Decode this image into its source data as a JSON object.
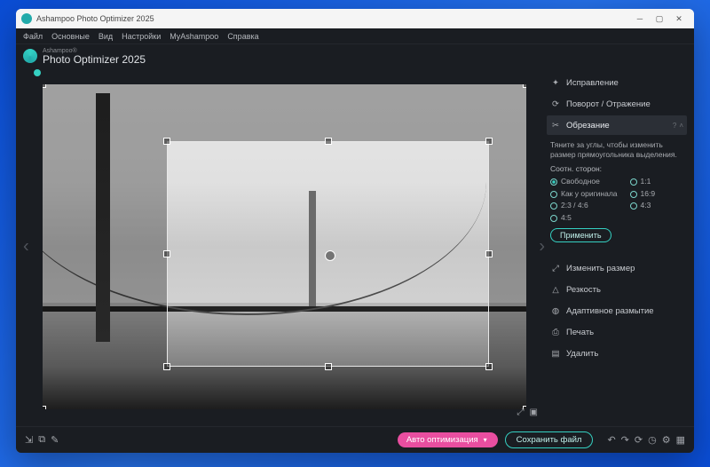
{
  "window": {
    "title": "Ashampoo Photo Optimizer 2025"
  },
  "menu": {
    "file": "Файл",
    "main": "Основные",
    "view": "Вид",
    "settings": "Настройки",
    "myashampoo": "MyAshampoo",
    "help": "Справка"
  },
  "brand": {
    "top": "Ashampoo®",
    "name": "Photo Optimizer 2025"
  },
  "rightPanel": {
    "fix": "Исправление",
    "rotate": "Поворот / Отражение",
    "crop": "Обрезание",
    "resize": "Изменить размер",
    "sharpen": "Резкость",
    "blur": "Адаптивное размытие",
    "print": "Печать",
    "delete": "Удалить"
  },
  "cropPanel": {
    "hint": "Тяните за углы, чтобы изменить размер прямоугольника выделения.",
    "ratioCaption": "Соотн. сторон:",
    "r_free": "Свободное",
    "r_orig": "Как у оригинала",
    "r_2346": "2:3 / 4:6",
    "r_45": "4:5",
    "r_11": "1:1",
    "r_169": "16:9",
    "r_43": "4:3",
    "apply": "Применить"
  },
  "bottom": {
    "auto": "Авто оптимизация",
    "save": "Сохранить файл"
  },
  "colors": {
    "accent": "#35d0c2",
    "primary": "#e94ea0"
  }
}
